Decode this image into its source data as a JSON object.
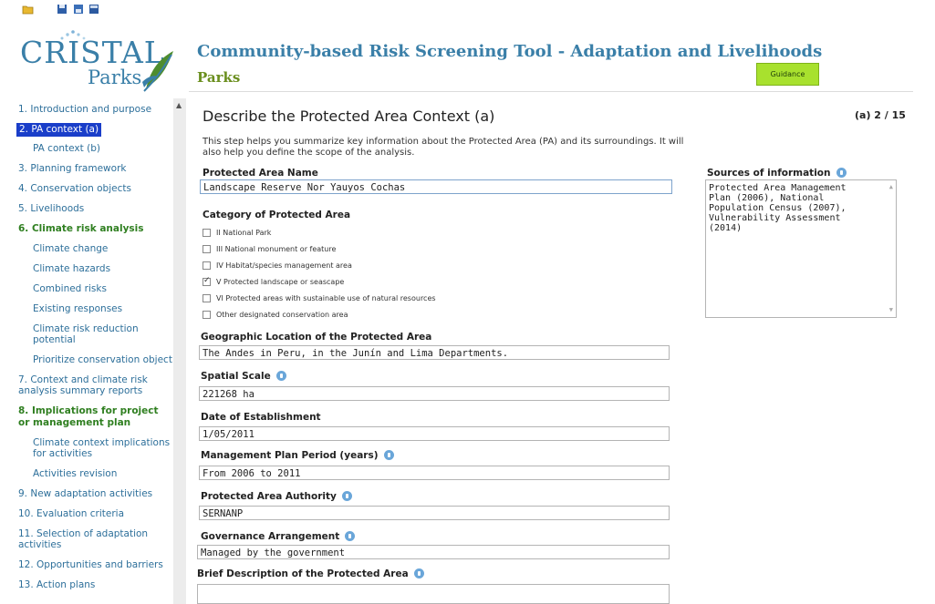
{
  "toolbar": {
    "icons": [
      "folder-open-icon",
      "save-icon",
      "save-as-icon",
      "export-icon"
    ]
  },
  "header": {
    "logo_main": "CRISTAL",
    "logo_sub": "Parks",
    "title": "Community-based Risk Screening Tool - Adaptation and Livelihoods",
    "subtitle": "Parks",
    "guidance_label": "Guidance",
    "colors": {
      "brand_blue": "#3a7fa8",
      "brand_green": "#6b8f1f",
      "guidance_bg": "#a8e12e",
      "active_nav": "#1a3ec9"
    }
  },
  "sidebar": {
    "items": [
      {
        "label": "1. Introduction and purpose"
      },
      {
        "label": "2. PA context (a)"
      },
      {
        "label": "PA context (b)"
      },
      {
        "label": "3. Planning framework"
      },
      {
        "label": "4. Conservation objects"
      },
      {
        "label": "5. Livelihoods"
      },
      {
        "label": "6. Climate risk analysis"
      },
      {
        "label": "Climate change"
      },
      {
        "label": "Climate hazards"
      },
      {
        "label": "Combined risks"
      },
      {
        "label": "Existing responses"
      },
      {
        "label": "Climate risk reduction"
      },
      {
        "label": "potential"
      },
      {
        "label": "Prioritize conservation object"
      },
      {
        "label": "7. Context and climate risk"
      },
      {
        "label": "analysis summary reports"
      },
      {
        "label": "8. Implications for project"
      },
      {
        "label": "or management plan"
      },
      {
        "label": "Climate context implications"
      },
      {
        "label": "for activities"
      },
      {
        "label": "Activities revision"
      },
      {
        "label": "9. New adaptation activities"
      },
      {
        "label": "10. Evaluation criteria"
      },
      {
        "label": "11. Selection of adaptation"
      },
      {
        "label": "activities"
      },
      {
        "label": "12. Opportunities and barriers"
      },
      {
        "label": "13. Action plans"
      }
    ]
  },
  "main": {
    "title": "Describe the Protected Area Context (a)",
    "counter": "(a) 2 / 15",
    "intro": "This step helps you summarize key information about the Protected Area (PA) and its surroundings. It will also help you define the scope of the analysis.",
    "pa_name": {
      "label": "Protected Area Name",
      "value": "Landscape Reserve Nor Yauyos Cochas"
    },
    "category": {
      "label": "Category of Protected Area",
      "options": [
        {
          "label": "II National Park",
          "checked": false
        },
        {
          "label": "III National monument or feature",
          "checked": false
        },
        {
          "label": "IV Habitat/species management area",
          "checked": false
        },
        {
          "label": "V Protected landscape or seascape",
          "checked": true
        },
        {
          "label": "VI Protected areas with sustainable use of natural resources",
          "checked": false
        },
        {
          "label": "Other designated conservation area",
          "checked": false
        }
      ]
    },
    "geo": {
      "label": "Geographic Location of the Protected Area",
      "value": "The Andes in Peru, in the Junín and Lima Departments."
    },
    "scale": {
      "label": "Spatial Scale",
      "value": "221268 ha"
    },
    "established": {
      "label": "Date of Establishment",
      "value": "1/05/2011"
    },
    "plan_period": {
      "label": "Management Plan Period (years)",
      "value": "From 2006 to 2011"
    },
    "authority": {
      "label": "Protected Area Authority",
      "value": "SERNANP"
    },
    "governance": {
      "label": "Governance Arrangement",
      "value": "Managed by the government"
    },
    "description": {
      "label": "Brief Description of the Protected Area",
      "value": ""
    },
    "sources": {
      "label": "Sources of information",
      "value": "Protected Area Management Plan (2006), National Population Census (2007), Vulnerability Assessment (2014)"
    }
  }
}
